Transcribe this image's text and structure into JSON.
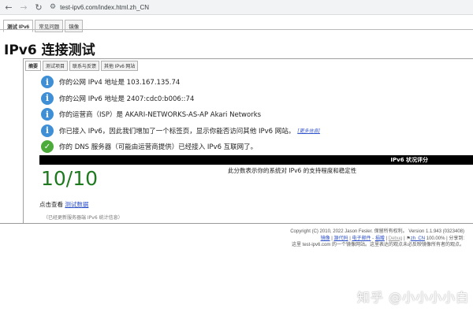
{
  "browser": {
    "back": "←",
    "forward": "→",
    "reload": "↻",
    "url": "test-ipv6.com/index.html.zh_CN"
  },
  "top_tabs": [
    "测试 IPv6",
    "常见问题",
    "镜像"
  ],
  "page_title": "IPv6 连接测试",
  "sub_tabs": [
    "摘要",
    "测试项目",
    "联系与反馈",
    "其他 IPv6 网站"
  ],
  "rows": [
    {
      "icon": "info-icon",
      "text": "你的公网 IPv4 地址是 103.167.135.74"
    },
    {
      "icon": "info-icon",
      "text": "你的公网 IPv6 地址是 2407:cdc0:b006::74"
    },
    {
      "icon": "info-icon",
      "text": "你的运营商（ISP）是 AKARI-NETWORKS-AS-AP Akari Networks"
    },
    {
      "icon": "info-icon",
      "text": "你已接入 IPv6，因此我们增加了一个标签页，显示你能否访问其他 IPv6 网站。",
      "link": "[更多信息]"
    },
    {
      "icon": "check-icon",
      "text": "你的 DNS 服务器（可能由运营商提供）已经接入 IPv6 互联网了。"
    }
  ],
  "score_header": "IPv6 状况评分",
  "score_value": "10/10",
  "score_description": "此分数表示你的系统对 IPv6 的支持程度和稳定性",
  "click_prefix": "点击查看",
  "click_link": "测试数据",
  "note": "（已经更新服务器端 IPv6 统计信息）",
  "footer": {
    "copyright": "Copyright (C) 2010, 2022 Jason Fesler. 保留所有权利。 Version 1.1.943 (0323408)",
    "links": [
      "镜像",
      "源代码",
      "电子邮件",
      "捐赠",
      "Debug",
      "zh_CN"
    ],
    "trail": "100.00%  |  分享到:",
    "mirror": "这里 test-ipv6.com 的一个镜像网站。这里表达的观点未必反映镜像所有者的观点。"
  },
  "watermark": "知乎 @小小小小白",
  "colors": {
    "info": "#3f8fd6",
    "ok": "#4caa3a",
    "score": "#1f7a1f",
    "link": "#2b4fc9"
  }
}
